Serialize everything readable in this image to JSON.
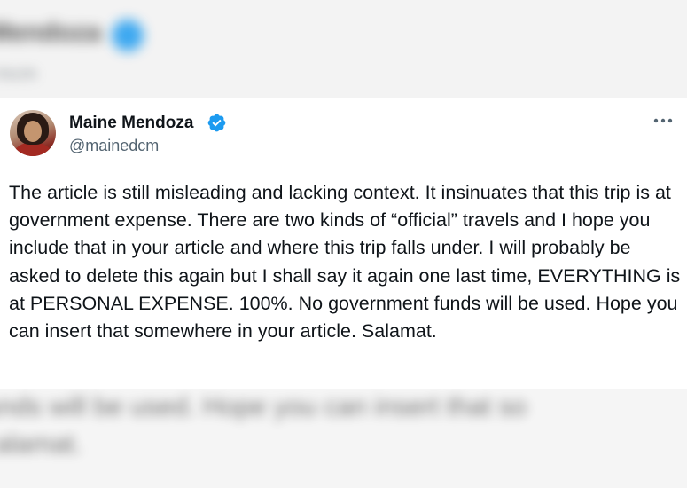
{
  "background": {
    "top_name": "Mendoza",
    "top_handle": "mcm",
    "bottom_line1": "unds will be used. Hope you can insert that so",
    "bottom_line2": "alamat."
  },
  "tweet": {
    "display_name": "Maine Mendoza",
    "handle": "@mainedcm",
    "text": "The article is still misleading and lacking context. It insinuates that this trip is at government expense. There are two kinds of “official” travels and I hope you include that in your article and where this trip falls under. I will probably be asked to delete this again but I shall say it again one last time, EVERYTHING is at PERSONAL EXPENSE. 100%. No government funds will be used. Hope you can insert that somewhere in your article. Salamat.",
    "verified_icon": "verified-badge-icon",
    "more_icon": "more-options-icon"
  },
  "colors": {
    "verified_blue": "#1d9bf0",
    "text_primary": "#0f1419",
    "text_secondary": "#536471"
  }
}
